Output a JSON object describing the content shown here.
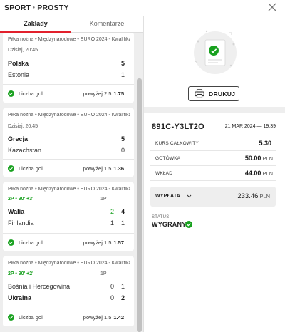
{
  "header": {
    "title_left": "SPORT",
    "title_sep": "•",
    "title_right": "PROSTY",
    "close_icon": "close-icon"
  },
  "tabs": [
    {
      "label": "Zakłady",
      "active": true
    },
    {
      "label": "Komentarze",
      "active": false
    }
  ],
  "bets": [
    {
      "breadcrumb": "Piłka nożna • Międzynarodowe • EURO 2024 - Kwalifikacje",
      "meta": "Dzisiaj, 20:45",
      "live": false,
      "half_label": "",
      "teams": [
        {
          "name": "Polska",
          "score": "5",
          "winner": true
        },
        {
          "name": "Estonia",
          "score": "1",
          "winner": false
        }
      ],
      "market": "Liczba goli",
      "selection": "powyżej 2.5",
      "odds": "1.75"
    },
    {
      "breadcrumb": "Piłka nożna • Międzynarodowe • EURO 2024 - Kwalifikacje",
      "meta": "Dzisiaj, 20:45",
      "live": false,
      "half_label": "",
      "teams": [
        {
          "name": "Grecja",
          "score": "5",
          "winner": true
        },
        {
          "name": "Kazachstan",
          "score": "0",
          "winner": false
        }
      ],
      "market": "Liczba goli",
      "selection": "powyżej 1.5",
      "odds": "1.36"
    },
    {
      "breadcrumb": "Piłka nożna • Międzynarodowe • EURO 2024 - Kwalifikacje",
      "meta": "2P • 90' +3'",
      "live": true,
      "half_label": "1P",
      "teams": [
        {
          "name": "Walia",
          "half_score": "2",
          "score": "4",
          "winner": true
        },
        {
          "name": "Finlandia",
          "half_score": "1",
          "score": "1",
          "winner": false
        }
      ],
      "market": "Liczba goli",
      "selection": "powyżej 1.5",
      "odds": "1.57"
    },
    {
      "breadcrumb": "Piłka nożna • Międzynarodowe • EURO 2024 - Kwalifikacje",
      "meta": "2P • 90' +2'",
      "live": true,
      "half_label": "1P",
      "teams": [
        {
          "name": "Bośnia i Hercegowina",
          "half_score": "0",
          "score": "1",
          "winner": false
        },
        {
          "name": "Ukraina",
          "half_score": "0",
          "score": "2",
          "winner": true
        }
      ],
      "market": "Liczba goli",
      "selection": "powyżej 1.5",
      "odds": "1.42"
    }
  ],
  "print": {
    "label": "DRUKUJ",
    "icon": "printer-icon"
  },
  "coupon": {
    "code": "891C-Y3LT2O",
    "date": "21 MAR 2024 — 19:39",
    "rows": [
      {
        "label": "KURS CAŁKOWITY",
        "value": "5.30",
        "currency": ""
      },
      {
        "label": "GOTÓWKA",
        "value": "50.00",
        "currency": "PLN"
      },
      {
        "label": "WKŁAD",
        "value": "44.00",
        "currency": "PLN"
      }
    ],
    "payout": {
      "label": "WYPŁATA",
      "value": "233.46",
      "currency": "PLN"
    },
    "status_label": "STATUS",
    "status_value": "WYGRANY"
  },
  "colors": {
    "accent_red": "#e2202c",
    "win_green": "#18a11f",
    "panel_bg": "#eeeeee"
  }
}
